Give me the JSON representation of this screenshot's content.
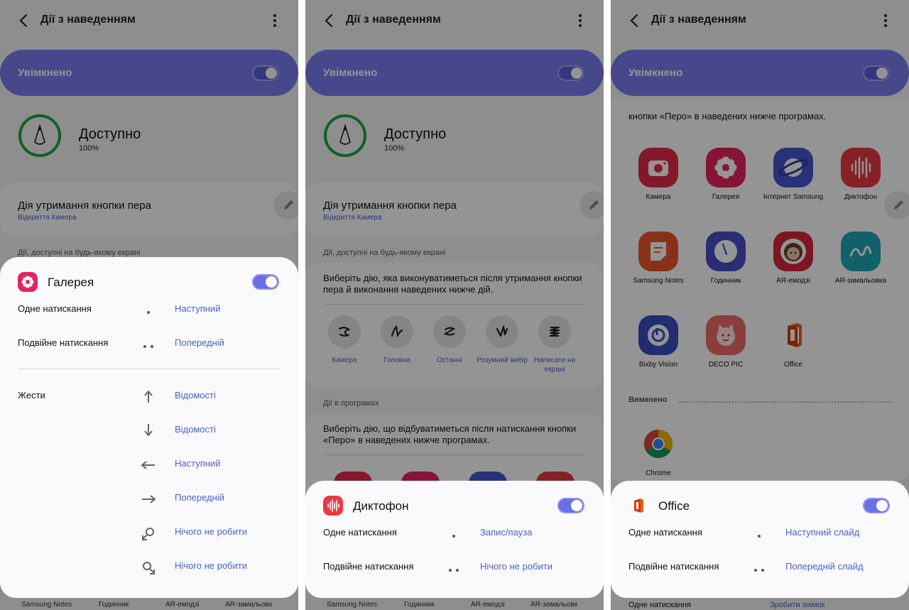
{
  "colors": {
    "accent": "#7a7df0",
    "link": "#4a5fc9",
    "ring": "#1fa53a",
    "gallery": "#e5245f",
    "recorder": "#e83a45",
    "office": "#d83b01"
  },
  "common": {
    "title": "Дії з наведенням",
    "master_label": "Увімкнено"
  },
  "panel1": {
    "status_title": "Доступно",
    "status_pct": "100%",
    "hold_title": "Дія утримання кнопки пера",
    "hold_sub": "Відкриття Камера",
    "section_any": "Дії, доступні на будь-якому екрані",
    "bottom": [
      "Samsung Notes",
      "Годинник",
      "AR-емодзі",
      "AR-замальовк"
    ],
    "sheet": {
      "title": "Галерея",
      "single_label": "Одне натискання",
      "single_value": "Наступний",
      "double_label": "Подвійне натискання",
      "double_value": "Попередній",
      "gestures_label": "Жести",
      "gestures": [
        {
          "icon": "arrow-up-icon",
          "value": "Відомості"
        },
        {
          "icon": "arrow-down-icon",
          "value": "Відомості"
        },
        {
          "icon": "arrow-left-icon",
          "value": "Наступний"
        },
        {
          "icon": "arrow-right-icon",
          "value": "Попередній"
        },
        {
          "icon": "rotate-ccw-icon",
          "value": "Нічого не робити"
        },
        {
          "icon": "rotate-cw-icon",
          "value": "Нічого не робити"
        }
      ]
    }
  },
  "panel2": {
    "status_title": "Доступно",
    "status_pct": "100%",
    "hold_title": "Дія утримання кнопки пера",
    "hold_sub": "Відкриття Камера",
    "section_any": "Дії, доступні на будь-якому екрані",
    "any_desc": "Виберіть дію, яка виконуватиметься після утримання кнопки пера й виконання наведених нижче дій.",
    "gestures": [
      {
        "label": "Камера"
      },
      {
        "label": "Головна"
      },
      {
        "label": "Останні"
      },
      {
        "label": "Розумний вибір"
      },
      {
        "label": "Написати на екрані"
      }
    ],
    "section_apps": "Дії в програмах",
    "apps_desc": "Виберіть дію, що відбуватиметься після натискання кнопки «Перо» в наведених нижче програмах.",
    "bottom": [
      "Samsung Notes",
      "Годинник",
      "AR-емодзі",
      "AR-замальовк"
    ],
    "sheet": {
      "title": "Диктофон",
      "single_label": "Одне натискання",
      "single_value": "Запис/пауза",
      "double_label": "Подвійне натискання",
      "double_value": "Нічого не робити"
    }
  },
  "panel3": {
    "apps_desc_tail": "кнопки «Перо» в наведених нижче програмах.",
    "apps": [
      {
        "label": "Камера",
        "icon": "camera-app-icon"
      },
      {
        "label": "Галерея",
        "icon": "gallery-app-icon"
      },
      {
        "label": "Інтернет Samsung",
        "icon": "internet-app-icon"
      },
      {
        "label": "Диктофон",
        "icon": "recorder-app-icon"
      },
      {
        "label": "Samsung Notes",
        "icon": "notes-app-icon"
      },
      {
        "label": "Годинник",
        "icon": "clock-app-icon"
      },
      {
        "label": "AR-емодзі",
        "icon": "ar-emoji-app-icon"
      },
      {
        "label": "AR-замальовка",
        "icon": "ar-doodle-app-icon"
      },
      {
        "label": "Bixby Vision",
        "icon": "bixby-vision-app-icon"
      },
      {
        "label": "DECO PIC",
        "icon": "deco-pic-app-icon"
      },
      {
        "label": "Office",
        "icon": "office-app-icon"
      }
    ],
    "off_label": "Вимкнено",
    "off_apps": [
      {
        "label": "Chrome",
        "icon": "chrome-app-icon"
      }
    ],
    "bottom_label": "Одне натискання",
    "bottom_value": "Зробити знімок",
    "sheet": {
      "title": "Office",
      "single_label": "Одне натискання",
      "single_value": "Наступний слайд",
      "double_label": "Подвійне натискання",
      "double_value": "Попередній слайд"
    }
  }
}
